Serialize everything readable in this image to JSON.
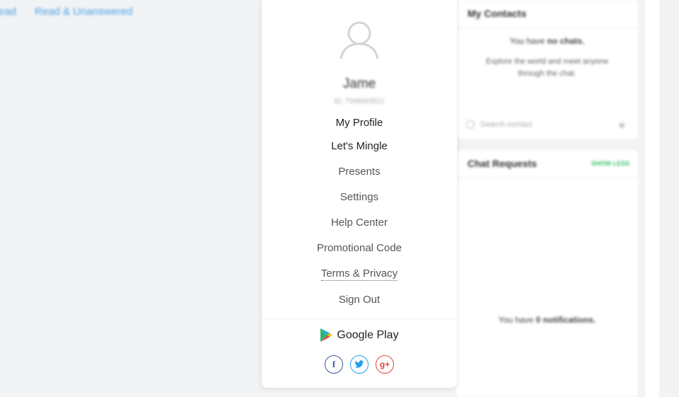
{
  "background": {
    "tabs": [
      "ead",
      "Read & Unanswered"
    ],
    "contacts": {
      "title": "My Contacts",
      "empty_prefix": "You have ",
      "empty_bold": "no chats.",
      "subtext": "Explore the world and meet anyone through the chat.",
      "search_placeholder": "Search contact"
    },
    "requests": {
      "title": "Chat Requests",
      "show_label": "SHOW LESS",
      "notif_prefix": "You have ",
      "notif_bold": "0 notifications."
    }
  },
  "menu": {
    "user_name": "Jame",
    "user_id": "ID: 7348003521",
    "items": [
      "My Profile",
      "Let's Mingle",
      "Presents",
      "Settings",
      "Help Center",
      "Promotional Code",
      "Terms & Privacy",
      "Sign Out"
    ],
    "store_label": "Google Play",
    "social": {
      "facebook": "f",
      "twitter": "twitter-icon",
      "google": "g+"
    }
  },
  "colors": {
    "link": "#4aa3e6",
    "accent_green": "#3bbf6a",
    "facebook": "#3b5998",
    "twitter": "#1da1f2",
    "google": "#dd4b39"
  }
}
